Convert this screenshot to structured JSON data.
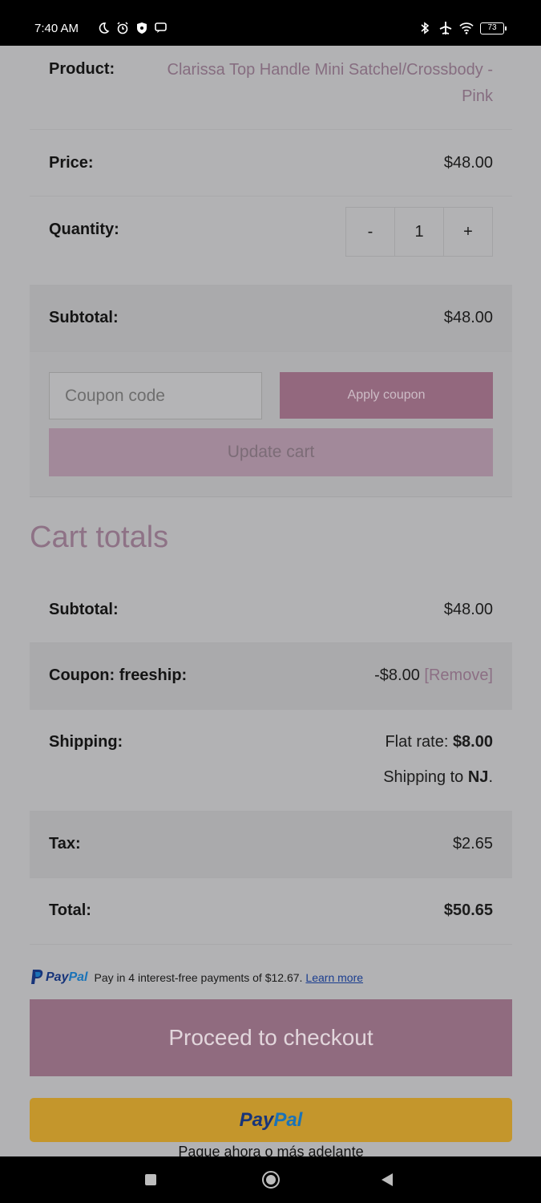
{
  "status_bar": {
    "time": "7:40 AM",
    "battery": "73",
    "left_icons": [
      "moon-icon",
      "alarm-icon",
      "shield-icon",
      "chat-icon"
    ],
    "right_icons": [
      "bluetooth-icon",
      "airplane-icon",
      "wifi-icon",
      "battery-icon"
    ]
  },
  "cart_item": {
    "product_label": "Product:",
    "product_name": "Clarissa Top Handle Mini Satchel/Crossbody - Pink",
    "price_label": "Price:",
    "price": "$48.00",
    "quantity_label": "Quantity:",
    "qty_minus": "-",
    "quantity": "1",
    "qty_plus": "+",
    "subtotal_label": "Subtotal:",
    "subtotal": "$48.00"
  },
  "coupon": {
    "placeholder": "Coupon code",
    "apply_label": "Apply coupon",
    "update_label": "Update cart"
  },
  "totals": {
    "title": "Cart totals",
    "subtotal_label": "Subtotal:",
    "subtotal": "$48.00",
    "coupon_label": "Coupon: freeship:",
    "coupon_amount": "-$8.00",
    "remove_label": "[Remove]",
    "shipping_label": "Shipping:",
    "shipping_method": "Flat rate:",
    "shipping_cost": "$8.00",
    "shipping_to_text": "Shipping to",
    "shipping_state": "NJ",
    "tax_label": "Tax:",
    "tax": "$2.65",
    "total_label": "Total:",
    "total": "$50.65"
  },
  "paypal": {
    "brand_pay": "Pay",
    "brand_pal": "Pal",
    "message": "Pay in 4 interest-free payments of $12.67.",
    "learn_more": "Learn more",
    "button_subtext": "Paque ahora o más adelante"
  },
  "checkout": {
    "proceed_label": "Proceed to checkout"
  },
  "colors": {
    "accent": "#906b7f",
    "paypal_yellow": "#c4962c",
    "paypal_navy": "#17347a",
    "paypal_blue": "#1a73b8"
  }
}
